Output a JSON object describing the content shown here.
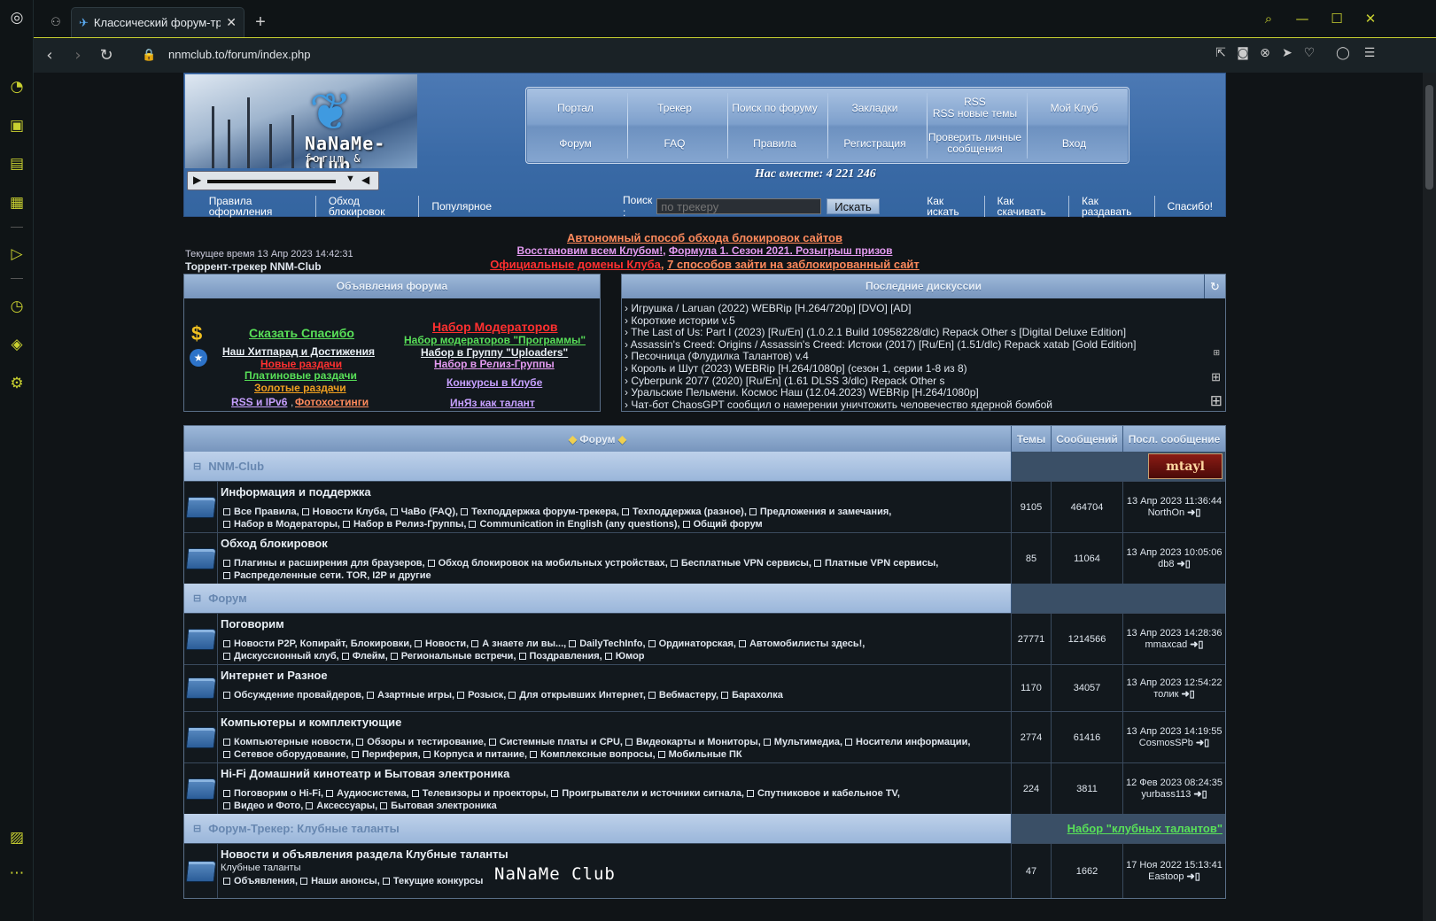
{
  "browser": {
    "tab_title": "Классический форум-трекер",
    "url": "nnmclub.to/forum/index.php"
  },
  "header": {
    "logo": "NaNaMe-Club",
    "logo_sub": "forum & tracker",
    "menu_row1": [
      "Портал",
      "Трекер",
      "Поиск по форуму",
      "Закладки",
      "RSS\nRSS новые темы",
      "Мой Клуб"
    ],
    "menu_row2": [
      "Форум",
      "FAQ",
      "Правила",
      "Регистрация",
      "Проверить личные\nсообщения",
      "Вход"
    ],
    "together": "Нас вместе: 4 221 246",
    "subnav_left": [
      "Правила оформления",
      "Обход блокировок",
      "Популярное"
    ],
    "search_label": "Поиск :",
    "search_placeholder": "по трекеру",
    "search_button": "Искать",
    "subnav_right": [
      "Как искать",
      "Как скачивать",
      "Как раздавать",
      "Спасибо!"
    ]
  },
  "info": {
    "time": "Текущее время 13 Апр 2023 14:42:31",
    "tracker_title": "Торрент-трекер NNM-Club",
    "ann1": "Автономный способ обхода блокировок сайтов",
    "ann2a": "Восстановим всем Клубом!",
    "ann2b": "Формула 1. Сезон 2021. Розыгрыш призов",
    "ann3a": "Официальные домены Клуба",
    "ann3b": "7 способов зайти на заблокированный сайт"
  },
  "announcements": {
    "title": "Объявления форума",
    "links": [
      "Сказать Спасибо",
      "Наш Хитпарад и Достижения",
      "Новые раздачи",
      "Платиновые раздачи",
      "Золотые раздачи",
      "RSS и IPv6",
      "Фотохостинги",
      "Набор Модераторов",
      "Набор модераторов \"Программы\"",
      "Набор в Группу \"Uploaders\"",
      "Набор в Релиз-Группы",
      "Конкурсы в Клубе",
      "ИнЯз как талант"
    ]
  },
  "discussions": {
    "title": "Последние дискуссии",
    "items": [
      "› Игрушка / Laruan (2022) WEBRip [H.264/720p] [DVO] [AD]",
      "› Короткие истории v.5",
      "› The Last of Us: Part I (2023) [Ru/En] (1.0.2.1 Build 10958228/dlc) Repack Other s [Digital Deluxe Edition]",
      "› Assassin's Creed: Origins / Assassin's Creed: Истоки (2017) [Ru/En] (1.51/dlc) Repack xatab [Gold Edition]",
      "› Песочница (Флудилка Талантов) v.4",
      "› Король и Шут (2023) WEBRip [H.264/1080p] (сезон 1, серии 1-8 из 8)",
      "› Cyberpunk 2077 (2020) [Ru/En] (1.61 DLSS 3/dlc) Repack Other s",
      "› Уральские Пельмени. Космос Наш (12.04.2023) WEBRip [H.264/1080p]",
      "› Чат-бот ChaosGPT сообщил о намерении уничтожить человечество ядерной бомбой"
    ]
  },
  "table": {
    "head": [
      "Форум",
      "Темы",
      "Сообщений",
      "Посл. сообщение"
    ],
    "cat1": "NNM-Club",
    "cat2": "Форум",
    "cat3": "Форум-Трекер: Клубные таланты",
    "cat3_link": "Набор \"клубных талантов\"",
    "banner": "mtayl",
    "rows": [
      {
        "name": "Информация и поддержка",
        "sub": "",
        "lines": [
          "Все Правила,  Новости Клуба,  ЧаВо (FAQ),  Техподдержка форум-трекера,  Техподдержка (разное),  Предложения и замечания,",
          "Набор в Модераторы,  Набор в Релиз-Группы,  Communication in English (any questions),  Общий форум"
        ],
        "topics": "9105",
        "posts": "464704",
        "date": "13 Апр 2023 11:36:44",
        "user": "NorthOn"
      },
      {
        "name": "Обход блокировок",
        "sub": "",
        "lines": [
          "Плагины и расширения для браузеров,  Обход блокировок на мобильных устройствах,  Бесплатные VPN сервисы,  Платные VPN сервисы,",
          "Распределенные сети. TOR, I2P и другие"
        ],
        "topics": "85",
        "posts": "11064",
        "date": "13 Апр 2023 10:05:06",
        "user": "db8"
      },
      {
        "name": "Поговорим",
        "sub": "",
        "lines": [
          "Новости P2P, Копирайт, Блокировки,  Новости,  А знаете ли вы...,  DailyTechInfo,  Ординаторская,  Автомобилисты здесь!,",
          "Дискуссионный клуб,  Флейм,  Региональные встречи,  Поздравления,  Юмор"
        ],
        "topics": "27771",
        "posts": "1214566",
        "date": "13 Апр 2023 14:28:36",
        "user": "mmaxcad"
      },
      {
        "name": "Интернет и Разное",
        "sub": "",
        "lines": [
          "Обсуждение провайдеров,  Азартные игры,  Розыск,  Для открывших Интернет,  Вебмастеру,  Барахолка"
        ],
        "topics": "1170",
        "posts": "34057",
        "date": "13 Апр 2023 12:54:22",
        "user": "толик"
      },
      {
        "name": "Компьютеры и комплектующие",
        "sub": "",
        "lines": [
          "Компьютерные новости,  Обзоры и тестирование,  Системные платы и CPU,  Видеокарты и Мониторы,  Мультимедиа,  Носители информации,",
          "Сетевое оборудование,  Периферия,  Корпуса и питание,  Комплексные вопросы,  Мобильные ПК"
        ],
        "topics": "2774",
        "posts": "61416",
        "date": "13 Апр 2023 14:19:55",
        "user": "CosmosSPb"
      },
      {
        "name": "Hi-Fi Домашний кинотеатр и Бытовая электроника",
        "sub": "",
        "lines": [
          "Поговорим о Hi-Fi,  Аудиосистема,  Телевизоры и проекторы,  Проигрыватели и источники сигнала,  Спутниковое и кабельное TV,",
          "Видео и Фото,  Аксессуары,  Бытовая электроника"
        ],
        "topics": "224",
        "posts": "3811",
        "date": "12 Фев 2023 08:24:35",
        "user": "yurbass113"
      },
      {
        "name": "Новости и объявления раздела Клубные таланты",
        "sub": "Клубные таланты",
        "lines": [
          "Объявления,  Наши анонсы,  Текущие конкурсы"
        ],
        "topics": "47",
        "posts": "1662",
        "date": "17 Ноя 2022 15:13:41",
        "user": "Eastoop"
      }
    ]
  },
  "watermark": "NaNaMe Club"
}
